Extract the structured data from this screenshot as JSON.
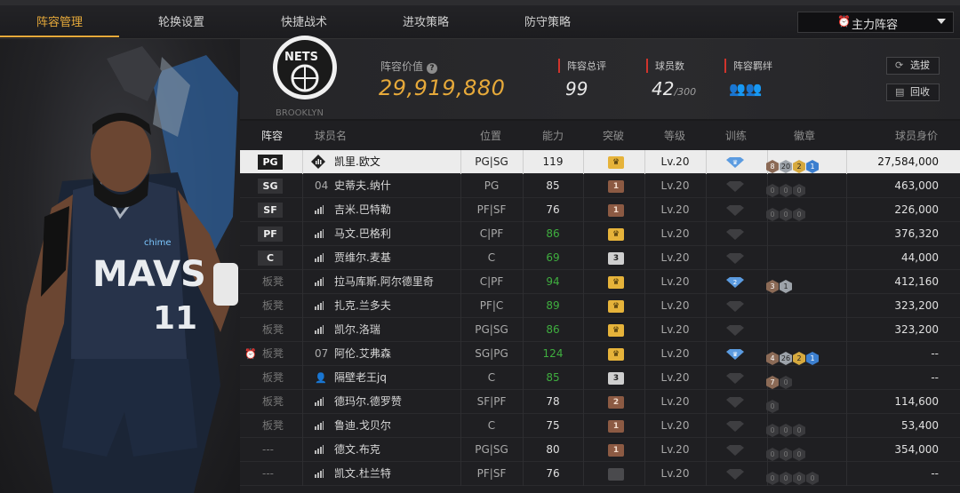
{
  "tabs": [
    {
      "label": "阵容管理",
      "active": true
    },
    {
      "label": "轮换设置",
      "active": false
    },
    {
      "label": "快捷战术",
      "active": false
    },
    {
      "label": "进攻策略",
      "active": false
    },
    {
      "label": "防守策略",
      "active": false
    }
  ],
  "lineup_selector": {
    "label": "主力阵容"
  },
  "team": {
    "logo_text": "NETS",
    "logo_subtext": "BROOKLYN",
    "value_label": "阵容价值",
    "value": "29,919,880",
    "overall_label": "阵容总评",
    "overall": "99",
    "count_label": "球员数",
    "count": "42",
    "count_max": "/300",
    "bond_label": "阵容羁绊",
    "pick_label": "选拔",
    "recycle_label": "回收"
  },
  "hero": {
    "jersey_text": "MAVS",
    "jersey_number": "11",
    "sponsor": "chime"
  },
  "columns": [
    "阵容",
    "球员名",
    "位置",
    "能力",
    "突破",
    "等级",
    "训练",
    "徽章",
    "球员身价"
  ],
  "rows": [
    {
      "slot": "PG",
      "bench": false,
      "prefix": "",
      "name": "凯里.欧文",
      "pos": "PG|SG",
      "ability": "119",
      "ability_green": false,
      "break": "gold",
      "break_text": "♛",
      "level": "Lv.20",
      "train": "blue",
      "train_text": "♛",
      "badges": [
        {
          "t": "8",
          "c": "brz"
        },
        {
          "t": "20",
          "c": "slv"
        },
        {
          "t": "2",
          "c": "gld"
        },
        {
          "t": "1",
          "c": "blu"
        }
      ],
      "value": "27,584,000",
      "selected": true,
      "name_icon": "card"
    },
    {
      "slot": "SG",
      "bench": false,
      "prefix": "04",
      "name": "史蒂夫.纳什",
      "pos": "PG",
      "ability": "85",
      "ability_green": false,
      "break": "brown",
      "break_text": "1",
      "level": "Lv.20",
      "train": "dim",
      "train_text": "",
      "badges": [
        {
          "t": "0",
          "c": "dim"
        },
        {
          "t": "0",
          "c": "dim"
        },
        {
          "t": "0",
          "c": "dim"
        }
      ],
      "value": "463,000",
      "name_icon": "none"
    },
    {
      "slot": "SF",
      "bench": false,
      "prefix": "",
      "name": "吉米.巴特勒",
      "pos": "PF|SF",
      "ability": "76",
      "ability_green": false,
      "break": "brown",
      "break_text": "1",
      "level": "Lv.20",
      "train": "dim",
      "train_text": "",
      "badges": [
        {
          "t": "0",
          "c": "dim"
        },
        {
          "t": "0",
          "c": "dim"
        },
        {
          "t": "0",
          "c": "dim"
        }
      ],
      "value": "226,000",
      "name_icon": "bars"
    },
    {
      "slot": "PF",
      "bench": false,
      "prefix": "",
      "name": "马文.巴格利",
      "pos": "C|PF",
      "ability": "86",
      "ability_green": true,
      "break": "gold",
      "break_text": "♛",
      "level": "Lv.20",
      "train": "dim",
      "train_text": "",
      "badges": [],
      "value": "376,320",
      "name_icon": "bars"
    },
    {
      "slot": "C",
      "bench": false,
      "prefix": "",
      "name": "贾维尔.麦基",
      "pos": "C",
      "ability": "69",
      "ability_green": true,
      "break": "grey",
      "break_text": "3",
      "level": "Lv.20",
      "train": "dim",
      "train_text": "",
      "badges": [],
      "value": "44,000",
      "name_icon": "bars"
    },
    {
      "slot": "板凳",
      "bench": true,
      "prefix": "",
      "name": "拉马库斯.阿尔德里奇",
      "pos": "C|PF",
      "ability": "94",
      "ability_green": true,
      "break": "gold",
      "break_text": "♛",
      "level": "Lv.20",
      "train": "blue",
      "train_text": "2",
      "badges": [
        {
          "t": "3",
          "c": "brz"
        },
        {
          "t": "1",
          "c": "slv"
        }
      ],
      "value": "412,160",
      "name_icon": "bars"
    },
    {
      "slot": "板凳",
      "bench": true,
      "prefix": "",
      "name": "扎克.兰多夫",
      "pos": "PF|C",
      "ability": "89",
      "ability_green": true,
      "break": "gold",
      "break_text": "♛",
      "level": "Lv.20",
      "train": "dim",
      "train_text": "",
      "badges": [],
      "value": "323,200",
      "name_icon": "bars"
    },
    {
      "slot": "板凳",
      "bench": true,
      "prefix": "",
      "name": "凯尔.洛瑞",
      "pos": "PG|SG",
      "ability": "86",
      "ability_green": true,
      "break": "gold",
      "break_text": "♛",
      "level": "Lv.20",
      "train": "dim",
      "train_text": "",
      "badges": [],
      "value": "323,200",
      "name_icon": "bars"
    },
    {
      "slot": "板凳",
      "bench": true,
      "alarm": true,
      "prefix": "07",
      "name": "阿伦.艾弗森",
      "pos": "SG|PG",
      "ability": "124",
      "ability_green": true,
      "break": "gold",
      "break_text": "♛",
      "level": "Lv.20",
      "train": "blue",
      "train_text": "♛",
      "badges": [
        {
          "t": "4",
          "c": "brz"
        },
        {
          "t": "26",
          "c": "slv"
        },
        {
          "t": "2",
          "c": "gld"
        },
        {
          "t": "1",
          "c": "blu"
        }
      ],
      "value": "--",
      "name_icon": "none"
    },
    {
      "slot": "板凳",
      "bench": true,
      "prefix": "",
      "name": "隔壁老王jq",
      "pos": "C",
      "ability": "85",
      "ability_green": true,
      "break": "grey",
      "break_text": "3",
      "level": "Lv.20",
      "train": "dim",
      "train_text": "",
      "badges": [
        {
          "t": "7",
          "c": "brz"
        },
        {
          "t": "0",
          "c": "dim"
        }
      ],
      "value": "--",
      "name_icon": "person"
    },
    {
      "slot": "板凳",
      "bench": true,
      "prefix": "",
      "name": "德玛尔.德罗赞",
      "pos": "SF|PF",
      "ability": "78",
      "ability_green": false,
      "break": "brown",
      "break_text": "2",
      "level": "Lv.20",
      "train": "dim",
      "train_text": "",
      "badges": [
        {
          "t": "0",
          "c": "dim"
        }
      ],
      "value": "114,600",
      "name_icon": "bars"
    },
    {
      "slot": "板凳",
      "bench": true,
      "prefix": "",
      "name": "鲁迪.戈贝尔",
      "pos": "C",
      "ability": "75",
      "ability_green": false,
      "break": "brown",
      "break_text": "1",
      "level": "Lv.20",
      "train": "dim",
      "train_text": "",
      "badges": [
        {
          "t": "0",
          "c": "dim"
        },
        {
          "t": "0",
          "c": "dim"
        },
        {
          "t": "0",
          "c": "dim"
        }
      ],
      "value": "53,400",
      "name_icon": "bars"
    },
    {
      "slot": "---",
      "bench": true,
      "prefix": "",
      "name": "德文.布克",
      "pos": "PG|SG",
      "ability": "80",
      "ability_green": false,
      "break": "brown",
      "break_text": "1",
      "level": "Lv.20",
      "train": "dim",
      "train_text": "",
      "badges": [
        {
          "t": "0",
          "c": "dim"
        },
        {
          "t": "0",
          "c": "dim"
        },
        {
          "t": "0",
          "c": "dim"
        }
      ],
      "value": "354,000",
      "name_icon": "bars"
    },
    {
      "slot": "---",
      "bench": true,
      "prefix": "",
      "name": "凯文.杜兰特",
      "pos": "PF|SF",
      "ability": "76",
      "ability_green": false,
      "break": "dim",
      "break_text": "",
      "level": "Lv.20",
      "train": "dim",
      "train_text": "",
      "badges": [
        {
          "t": "0",
          "c": "dim"
        },
        {
          "t": "0",
          "c": "dim"
        },
        {
          "t": "0",
          "c": "dim"
        },
        {
          "t": "0",
          "c": "dim"
        }
      ],
      "value": "--",
      "name_icon": "bars"
    }
  ],
  "colors": {
    "accent": "#e6a93a",
    "red_marker": "#d0342c",
    "green": "#3fae3f"
  }
}
